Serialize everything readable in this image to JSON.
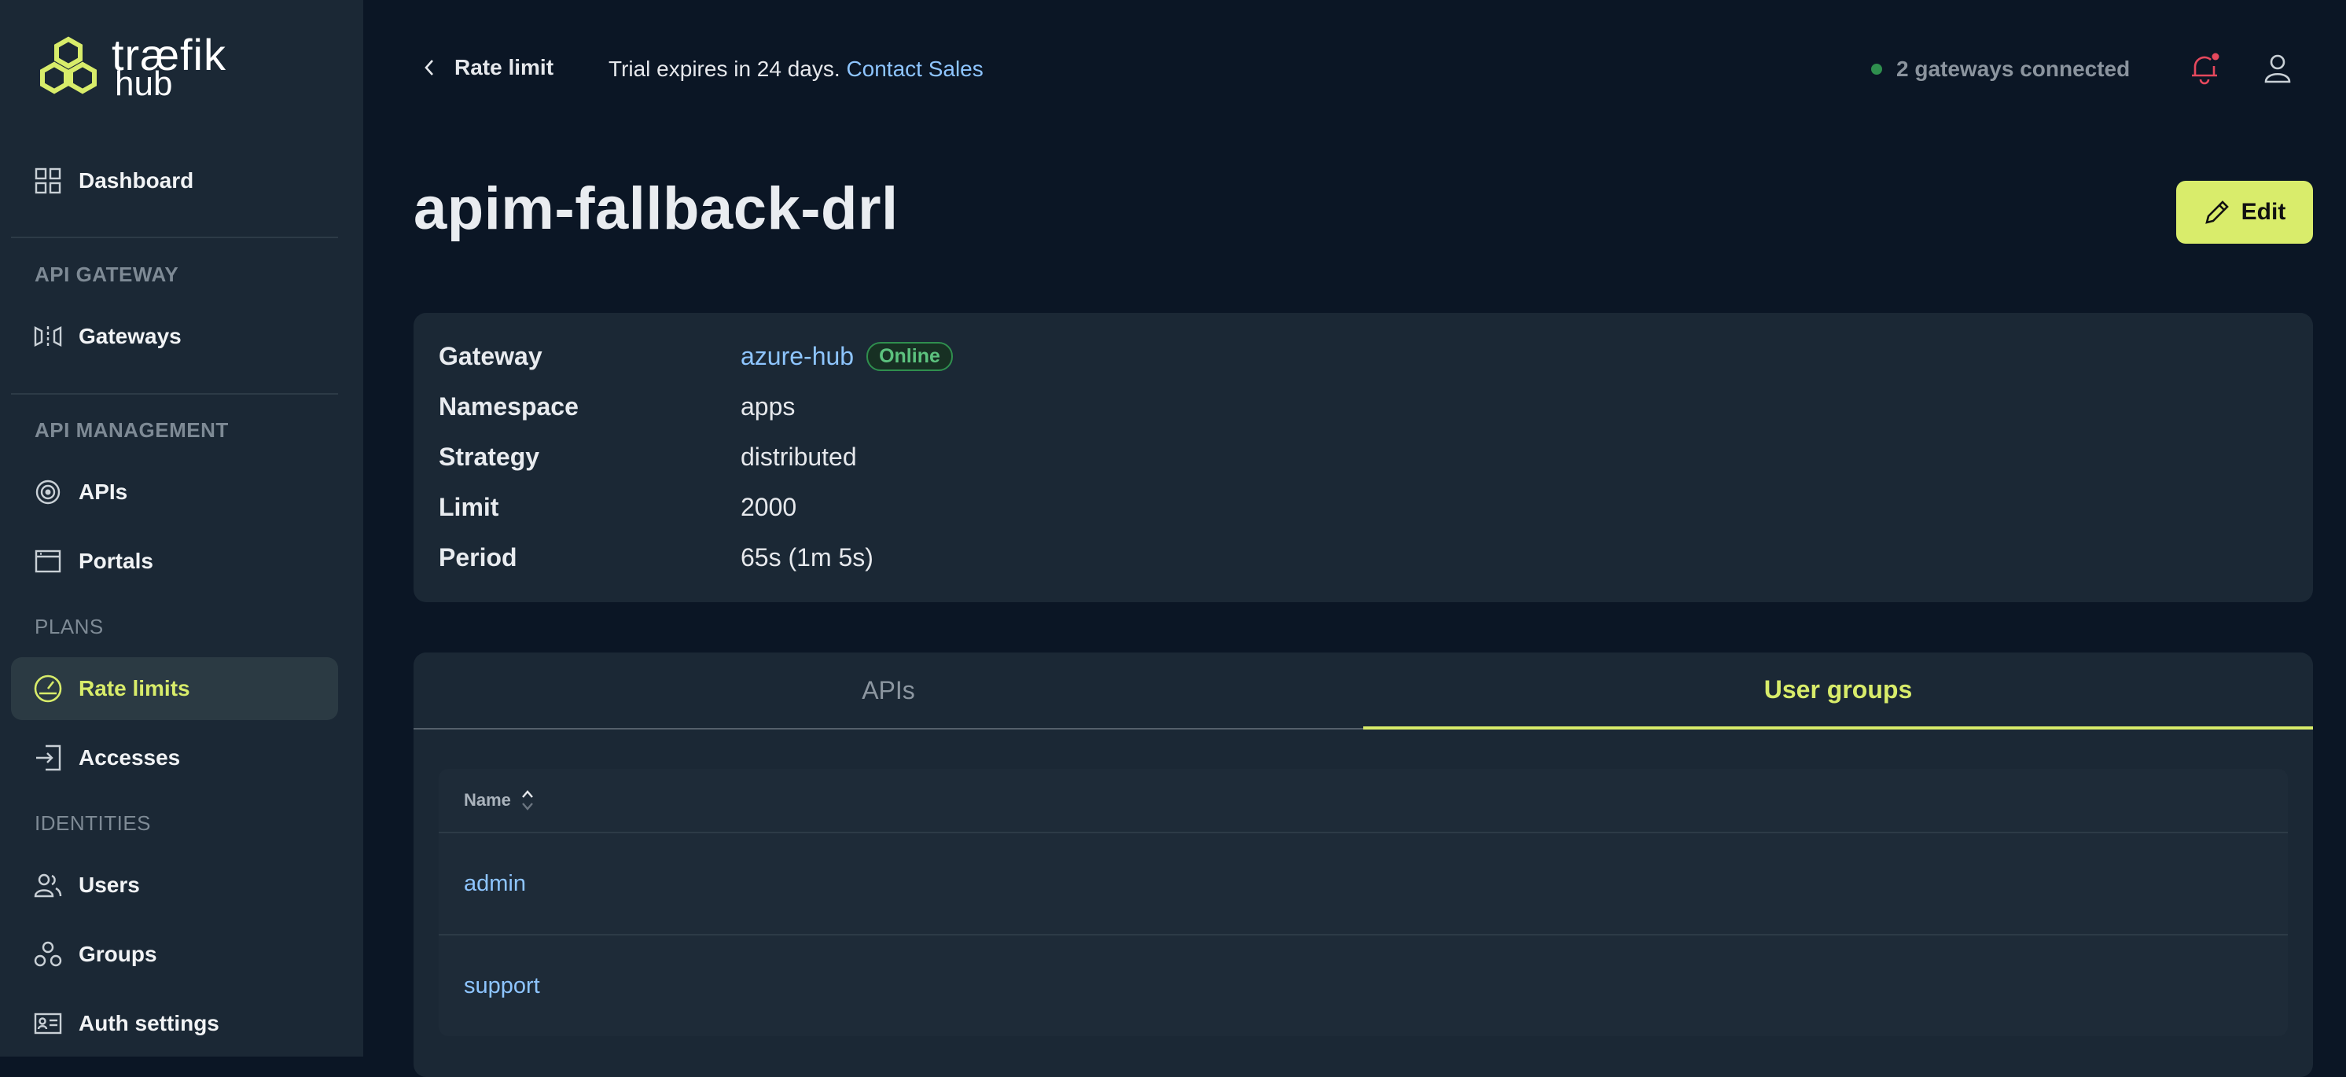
{
  "brand": {
    "name_top": "træfik",
    "name_bottom": "hub"
  },
  "sidebar": {
    "dashboard": "Dashboard",
    "sections": {
      "api_gateway": "API GATEWAY",
      "api_management": "API MANAGEMENT",
      "plans": "PLANS",
      "identities": "IDENTITIES"
    },
    "items": {
      "gateways": "Gateways",
      "apis": "APIs",
      "portals": "Portals",
      "rate_limits": "Rate limits",
      "accesses": "Accesses",
      "users": "Users",
      "groups": "Groups",
      "auth_settings": "Auth settings"
    }
  },
  "topbar": {
    "back_label": "Rate limit",
    "trial_text": "Trial expires in 24 days.",
    "contact_sales": "Contact Sales",
    "gateways_status": "2 gateways connected"
  },
  "page": {
    "title": "apim-fallback-drl",
    "edit_label": "Edit"
  },
  "details": [
    {
      "key": "Gateway",
      "value": "azure-hub",
      "badge": "Online"
    },
    {
      "key": "Namespace",
      "value": "apps"
    },
    {
      "key": "Strategy",
      "value": "distributed"
    },
    {
      "key": "Limit",
      "value": "2000"
    },
    {
      "key": "Period",
      "value": "65s (1m 5s)"
    }
  ],
  "tabs": [
    "APIs",
    "User groups"
  ],
  "table": {
    "header": "Name",
    "rows": [
      "admin",
      "support"
    ]
  },
  "colors": {
    "accent": "#d8ec6a",
    "link": "#8ec5ff",
    "online": "#2f8f4e",
    "notification": "#e5485d"
  }
}
